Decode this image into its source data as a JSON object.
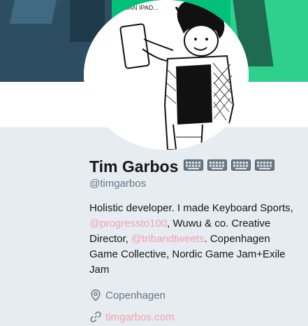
{
  "profile": {
    "name": "Tim Garbos",
    "handle": "@timgarbos",
    "avatar_caption": "SAN IPAD...",
    "name_emoji": [
      "keyboard-emoji",
      "keyboard-emoji",
      "keyboard-emoji",
      "keyboard-emoji"
    ]
  },
  "bio": {
    "part1": "Holistic developer. I made Keyboard Sports, ",
    "mention1": "@progressto100",
    "part2": ", Wuwu & co. Creative Director, ",
    "mention2": "@tribandtweets",
    "part3": ". Copenhagen Game Collective, Nordic Game Jam+Exile Jam"
  },
  "location": {
    "icon": "location-pin-icon",
    "text": "Copenhagen"
  },
  "website": {
    "icon": "link-icon",
    "text": "timgarbos.com"
  },
  "colors": {
    "link": "#f5a1b2",
    "banner_green": "#00c07a",
    "page_bg": "#e6ecf0",
    "secondary_text": "#657786"
  }
}
